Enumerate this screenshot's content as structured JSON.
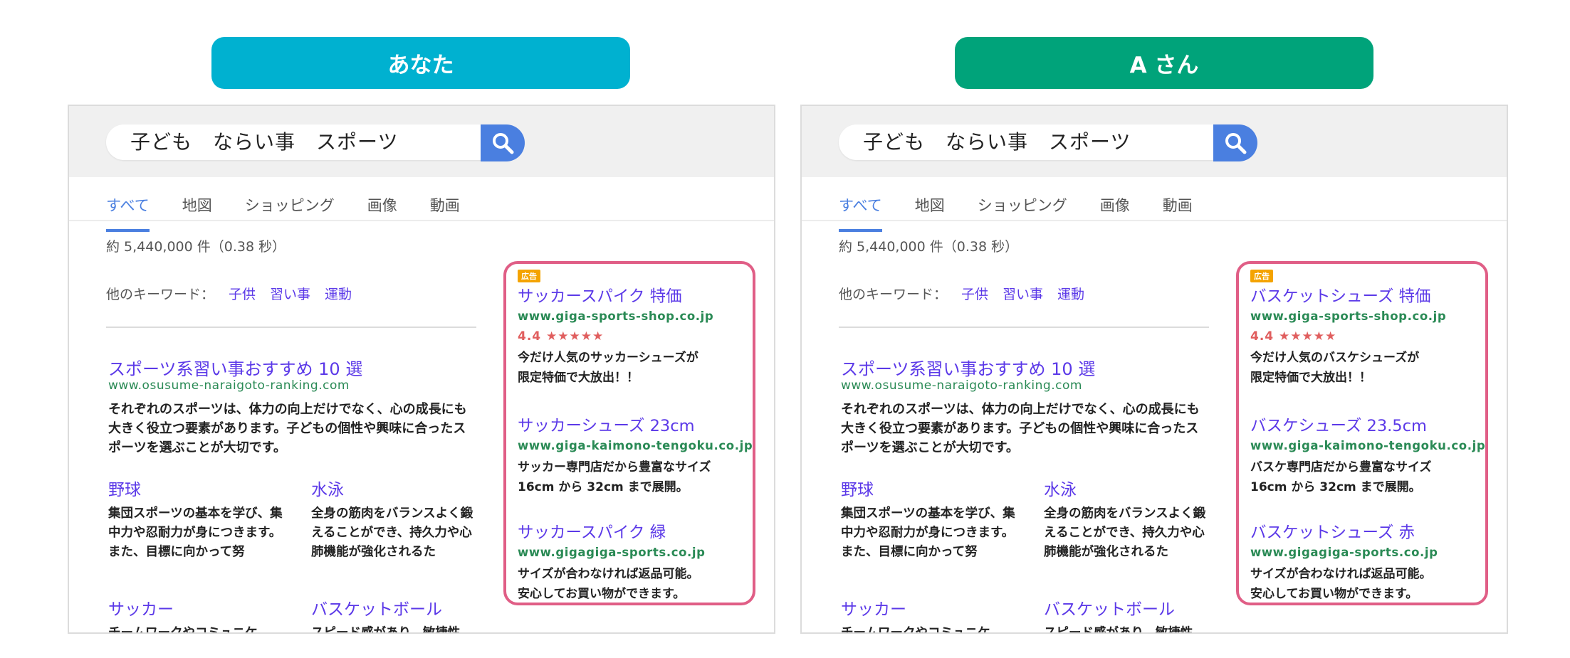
{
  "panels": [
    {
      "label": "あなた",
      "label_color": "#00b1d0",
      "search_query": "子ども　ならい事　スポーツ",
      "tabs": [
        "すべて",
        "地図",
        "ショッピング",
        "画像",
        "動画"
      ],
      "result_count": "約 5,440,000 件（0.38 秒）",
      "other_keywords_label": "他のキーワード：",
      "other_keywords": [
        "子供",
        "習い事",
        "運動"
      ],
      "main_result": {
        "title": "スポーツ系習い事おすすめ 10 選",
        "url": "www.osusume-naraigoto-ranking.com",
        "desc": "それぞれのスポーツは、体力の向上だけでなく、心の成長にも大きく役立つ要素があります。子どもの個性や興味に合ったスポーツを選ぶことが大切です。"
      },
      "sub_results": [
        {
          "title": "野球",
          "desc": "集団スポーツの基本を学び、集中力や忍耐力が身につきます。また、目標に向かって努"
        },
        {
          "title": "水泳",
          "desc": "全身の筋肉をバランスよく鍛えることができ、持久力や心肺機能が強化されるた"
        },
        {
          "title": "サッカー",
          "desc": "チームワークやコミュニケ"
        },
        {
          "title": "バスケットボール",
          "desc": "スピード感があり、敏捷性"
        }
      ],
      "ad_badge": "広告",
      "ads": [
        {
          "title": "サッカースパイク 特価",
          "url": "www.giga-sports-shop.co.jp",
          "rating": "4.4 ★★★★★",
          "desc": [
            "今だけ人気のサッカーシューズが",
            "限定特価で大放出！！"
          ]
        },
        {
          "title": "サッカーシューズ 23cm",
          "url": "www.giga-kaimono-tengoku.co.jp",
          "desc": [
            "サッカー専門店だから豊富なサイズ",
            "16cm から 32cm まで展開。"
          ]
        },
        {
          "title": "サッカースパイク 緑",
          "url": "www.gigagiga-sports.co.jp",
          "desc": [
            "サイズが合わなければ返品可能。",
            "安心してお買い物ができます。"
          ]
        }
      ]
    },
    {
      "label": "A さん",
      "label_color": "#00a37a",
      "search_query": "子ども　ならい事　スポーツ",
      "tabs": [
        "すべて",
        "地図",
        "ショッピング",
        "画像",
        "動画"
      ],
      "result_count": "約 5,440,000 件（0.38 秒）",
      "other_keywords_label": "他のキーワード：",
      "other_keywords": [
        "子供",
        "習い事",
        "運動"
      ],
      "main_result": {
        "title": "スポーツ系習い事おすすめ 10 選",
        "url": "www.osusume-naraigoto-ranking.com",
        "desc": "それぞれのスポーツは、体力の向上だけでなく、心の成長にも大きく役立つ要素があります。子どもの個性や興味に合ったスポーツを選ぶことが大切です。"
      },
      "sub_results": [
        {
          "title": "野球",
          "desc": "集団スポーツの基本を学び、集中力や忍耐力が身につきます。また、目標に向かって努"
        },
        {
          "title": "水泳",
          "desc": "全身の筋肉をバランスよく鍛えることができ、持久力や心肺機能が強化されるた"
        },
        {
          "title": "サッカー",
          "desc": "チームワークやコミュニケ"
        },
        {
          "title": "バスケットボール",
          "desc": "スピード感があり、敏捷性"
        }
      ],
      "ad_badge": "広告",
      "ads": [
        {
          "title": "バスケットシューズ 特価",
          "url": "www.giga-sports-shop.co.jp",
          "rating": "4.4 ★★★★★",
          "desc": [
            "今だけ人気のバスケシューズが",
            "限定特価で大放出！！"
          ]
        },
        {
          "title": "バスケシューズ 23.5cm",
          "url": "www.giga-kaimono-tengoku.co.jp",
          "desc": [
            "バスケ専門店だから豊富なサイズ",
            "16cm から 32cm まで展開。"
          ]
        },
        {
          "title": "バスケットシューズ 赤",
          "url": "www.gigagiga-sports.co.jp",
          "desc": [
            "サイズが合わなければ返品可能。",
            "安心してお買い物ができます。"
          ]
        }
      ]
    }
  ]
}
